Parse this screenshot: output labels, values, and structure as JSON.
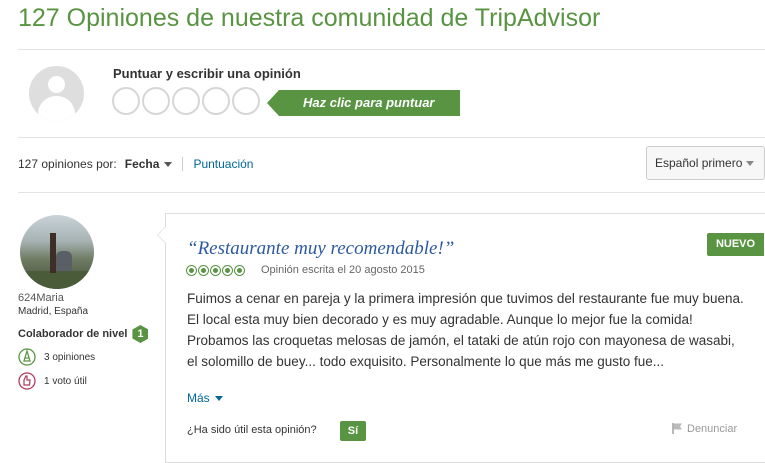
{
  "header": {
    "title": "127 Opiniones de nuestra comunidad de TripAdvisor"
  },
  "rate": {
    "title": "Puntuar y escribir una opinión",
    "cta": "Haz clic para puntuar"
  },
  "sort": {
    "prefix": "127 opiniones por:",
    "active": "Fecha",
    "alternative": "Puntuación"
  },
  "language_select": {
    "value": "Español primero"
  },
  "reviewer": {
    "name": "624Maria",
    "location": "Madrid, España",
    "level_label": "Colaborador de nivel",
    "level": "1",
    "reviews": "3 opiniones",
    "helpful_votes": "1 voto útil"
  },
  "review": {
    "badge": "NUEVO",
    "title": "“Restaurante muy recomendable!”",
    "rating": 5,
    "date_text": "Opinión escrita el 20 agosto 2015",
    "body": "Fuimos a cenar en pareja y la primera impresión que tuvimos del restaurante fue muy buena. El local esta muy bien decorado y es muy agradable. Aunque lo mejor fue la comida! Probamos las croquetas melosas de jamón, el tataki de atún rojo con mayonesa de wasabi, el solomillo de buey... todo exquisito. Personalmente lo que más me gusto fue...",
    "more_label": "Más",
    "helpful_question": "¿Ha sido útil esta opinión?",
    "yes_label": "Sí",
    "report_label": "Denunciar"
  },
  "colors": {
    "accent": "#589442",
    "link": "#006699",
    "title_link": "#2c5aa0"
  },
  "icons": {
    "rating_bubbles": "empty-bubble-icon",
    "review_count": "pen-icon",
    "helpful": "thumbs-up-icon",
    "report": "flag-icon"
  }
}
